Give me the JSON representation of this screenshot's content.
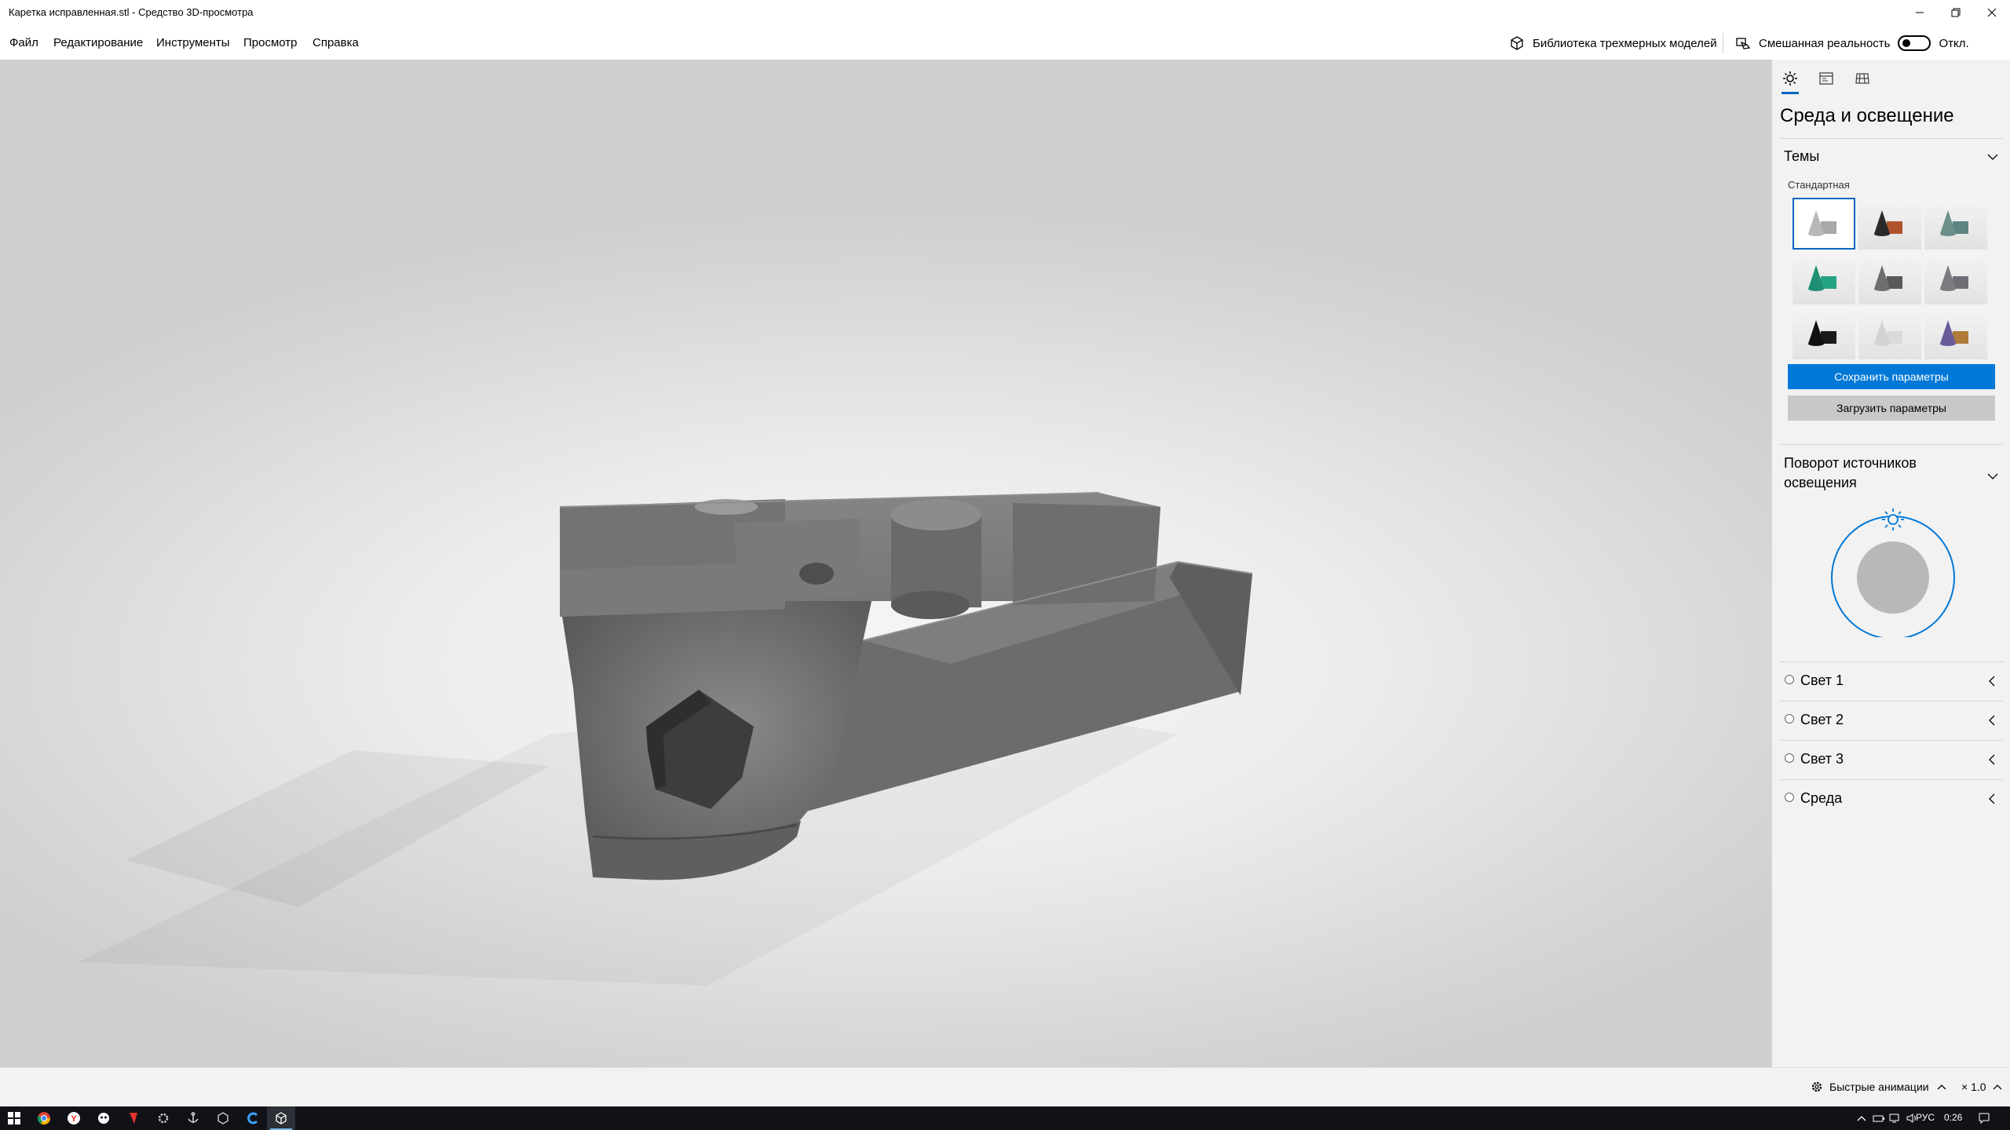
{
  "window": {
    "title": "Каретка исправленная.stl - Средство 3D-просмотра",
    "controls": [
      "minimize-icon",
      "restore-icon",
      "close-icon"
    ]
  },
  "menu": {
    "items": [
      "Файл",
      "Редактирование",
      "Инструменты",
      "Просмотр",
      "Справка"
    ],
    "library_label": "Библиотека трехмерных моделей",
    "mixed_reality_label": "Смешанная реальность",
    "mixed_reality_state": "Откл."
  },
  "panel": {
    "tabs": [
      "sun-icon",
      "stats-icon",
      "grid-icon"
    ],
    "title": "Среда и освещение",
    "themes_section": "Темы",
    "themes_subcaption": "Стандартная",
    "themes": [
      {
        "name": "standard",
        "cone": "#b8b8b8",
        "box": "#a8a8a8",
        "selected": true
      },
      {
        "name": "copper",
        "cone": "#2a2a2a",
        "box": "#b0532c",
        "selected": false
      },
      {
        "name": "teal-gray",
        "cone": "#6c8f8a",
        "box": "#5e8580",
        "selected": false
      },
      {
        "name": "green",
        "cone": "#1e8f72",
        "box": "#24a383",
        "selected": false
      },
      {
        "name": "dark-gray",
        "cone": "#6e6e6e",
        "box": "#5a5a5a",
        "selected": false
      },
      {
        "name": "slate",
        "cone": "#7a7a80",
        "box": "#6e6e74",
        "selected": false
      },
      {
        "name": "black",
        "cone": "#111111",
        "box": "#1a1a1a",
        "selected": false
      },
      {
        "name": "light",
        "cone": "#d4d4d4",
        "box": "#dadada",
        "selected": false
      },
      {
        "name": "gold-purple",
        "cone": "#6a5a9a",
        "box": "#b07a3a",
        "selected": false
      }
    ],
    "save_button": "Сохранить параметры",
    "load_button": "Загрузить параметры",
    "rotation_section": "Поворот источников освещения",
    "lights": [
      "Свет 1",
      "Свет 2",
      "Свет 3",
      "Среда"
    ]
  },
  "status": {
    "animations_label": "Быстрые анимации",
    "speed_label": "× 1.0"
  },
  "taskbar": {
    "apps": [
      "start-icon",
      "chrome-icon",
      "yandex-icon",
      "app-icon",
      "adobe-icon",
      "settings-app-icon",
      "anchor-icon",
      "cube-app-icon",
      "ccleaner-icon",
      "3d-viewer-icon"
    ],
    "lang": "РУС",
    "time": "0:26"
  },
  "colors": {
    "accent": "#0078d7",
    "model": "#6b6b6b",
    "taskbar": "#101218"
  }
}
